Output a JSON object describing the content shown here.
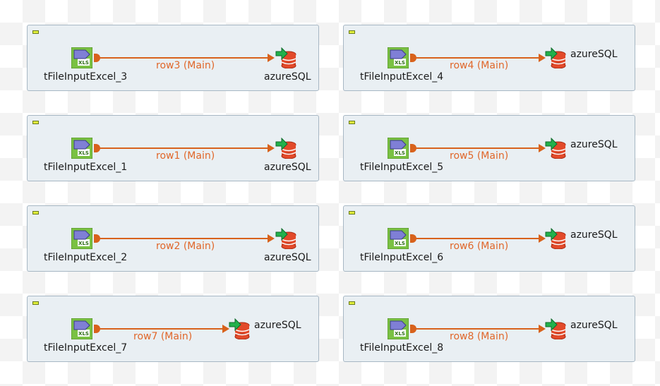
{
  "design": {
    "subjobs": [
      {
        "input": "tFileInputExcel_3",
        "connection": "row3 (Main)",
        "output": "azureSQL"
      },
      {
        "input": "tFileInputExcel_4",
        "connection": "row4 (Main)",
        "output": "azureSQL"
      },
      {
        "input": "tFileInputExcel_1",
        "connection": "row1 (Main)",
        "output": "azureSQL"
      },
      {
        "input": "tFileInputExcel_5",
        "connection": "row5 (Main)",
        "output": "azureSQL"
      },
      {
        "input": "tFileInputExcel_2",
        "connection": "row2 (Main)",
        "output": "azureSQL"
      },
      {
        "input": "tFileInputExcel_6",
        "connection": "row6 (Main)",
        "output": "azureSQL"
      },
      {
        "input": "tFileInputExcel_7",
        "connection": "row7 (Main)",
        "output": "azureSQL"
      },
      {
        "input": "tFileInputExcel_8",
        "connection": "row8 (Main)",
        "output": "azureSQL"
      }
    ]
  },
  "icons": {
    "input": "excel-input-icon",
    "output": "database-output-icon",
    "collapse": "collapse-icon"
  },
  "colors": {
    "connection": "#d8621c",
    "connection_label": "#e0672a",
    "subjob_bg": "#e9eff3",
    "subjob_border": "#a7b7c4",
    "excel_green": "#7ac143",
    "db_red": "#e24a2a",
    "arrow_green": "#22b14c"
  }
}
